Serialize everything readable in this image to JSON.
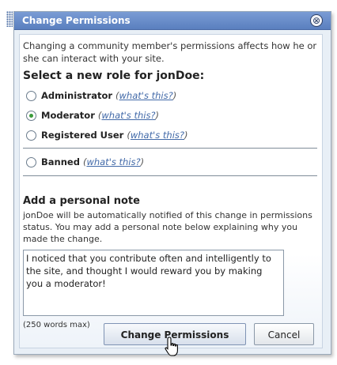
{
  "dialog": {
    "title": "Change Permissions",
    "intro": "Changing a community member's permissions affects how he or she can interact with your site.",
    "heading": "Select a new role for jonDoe:",
    "roles": [
      {
        "label": "Administrator",
        "link": "what's this?",
        "selected": false
      },
      {
        "label": "Moderator",
        "link": "what's this?",
        "selected": true
      },
      {
        "label": "Registered User",
        "link": "what's this?",
        "selected": false
      },
      {
        "label": "Banned",
        "link": "what's this?",
        "selected": false
      }
    ],
    "note_heading": "Add a personal note",
    "note_description": "jonDoe will be automatically notified of this change in permissions status. You may add a personal note below explaining why you made the change.",
    "note_value": "I noticed that you contribute often and intelligently to the site, and thought I would reward you by making you a moderator!",
    "word_limit": "(250 words max)",
    "submit_label": "Change Permissions",
    "cancel_label": "Cancel"
  }
}
